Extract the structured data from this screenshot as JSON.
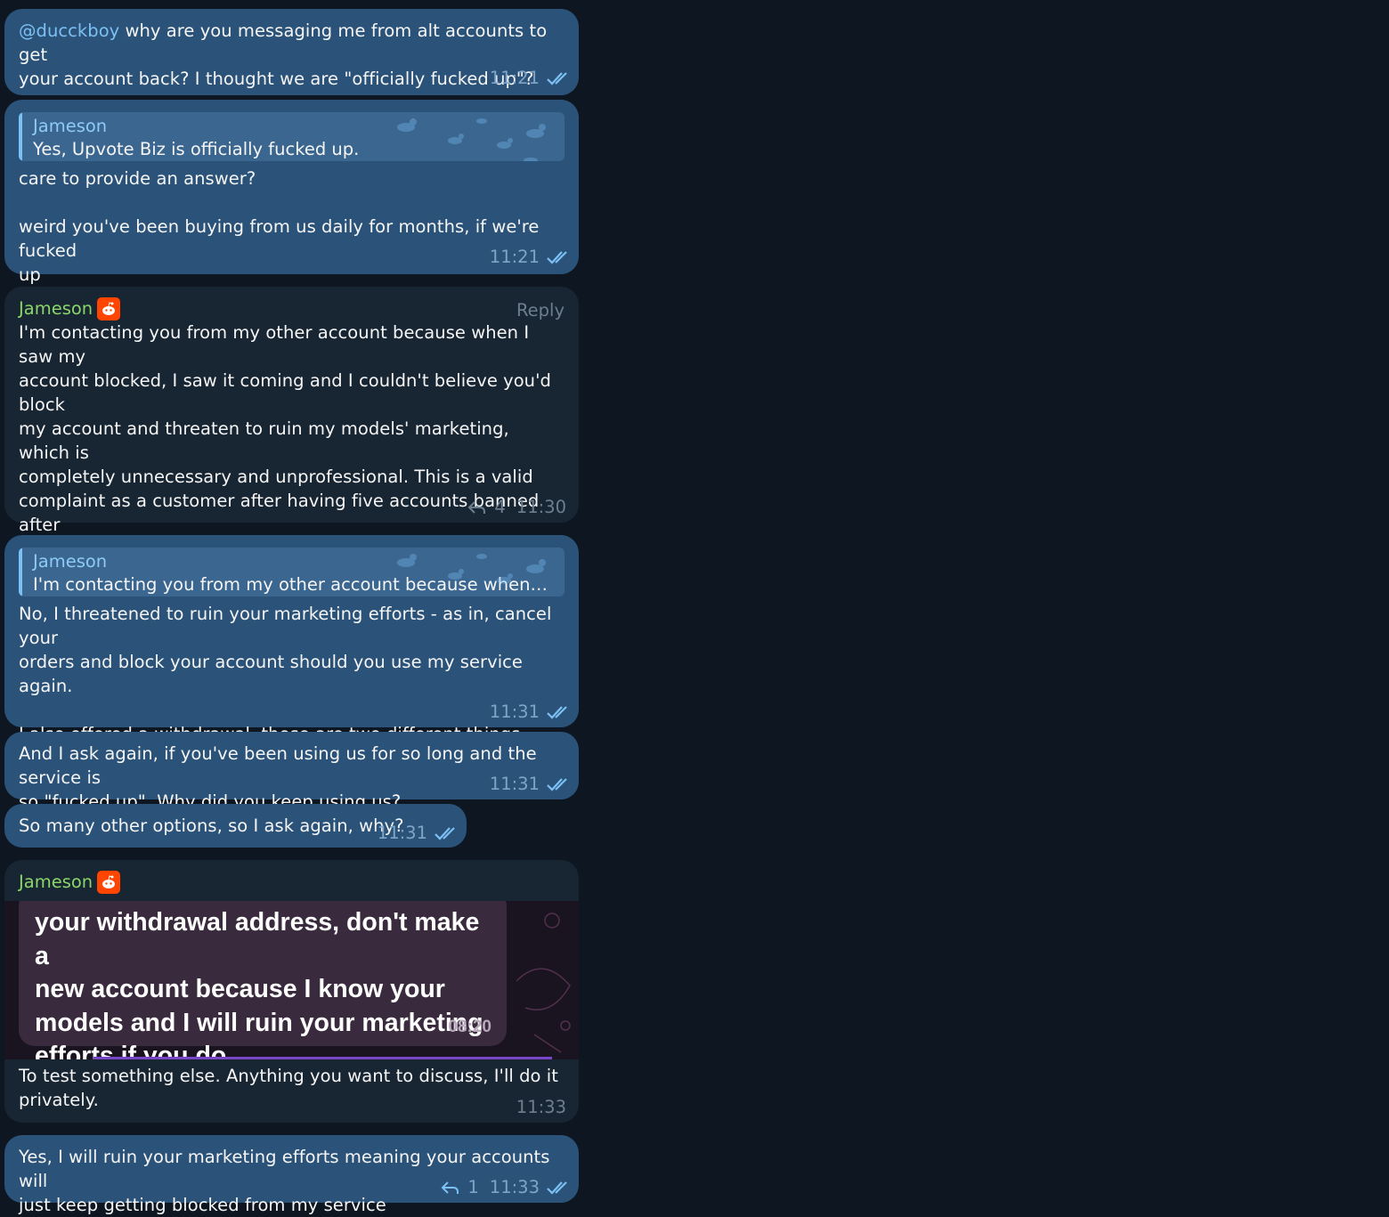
{
  "messages": {
    "m1": {
      "mention": "@ducckboy",
      "text": " why are you messaging me from alt accounts to get\nyour account back? I thought we are \"officially fucked up\"?",
      "time": "11:21"
    },
    "m2": {
      "quote_name": "Jameson",
      "quote_text": "Yes, Upvote Biz is officially fucked up.",
      "text": "care to provide an answer?\n\nweird you've been buying from us daily for months, if we're fucked\nup",
      "time": "11:21"
    },
    "m3": {
      "sender": "Jameson",
      "reply_label": "Reply",
      "text": "I'm contacting you from my other account because when I saw my\naccount blocked, I saw it coming and I couldn't believe you'd block\nmy account and threaten to ruin my models' marketing, which is\ncompletely unnecessary and unprofessional. This is a valid\ncomplaint as a customer after having five accounts banned after\nusing the service; it's not a personal attack. Nothing new, and as\nmessed up as many other things that are said. But it's fine, I won't\nuse the service again.",
      "reply_count": "4",
      "time": "11:30"
    },
    "m4": {
      "quote_name": "Jameson",
      "quote_text": "I'm contacting you from my other account because when I saw ...",
      "text": "No, I threatened to ruin your marketing efforts - as in, cancel your\norders and block your account should you use my service again.\n\nI also offered a withdrawal, these are two different things.",
      "time": "11:31"
    },
    "m5": {
      "text": "And I ask again, if you've been using us for so long and the service is\nso \"fucked up\". Why did you keep using us?",
      "time": "11:31"
    },
    "m6": {
      "text": "So many other options, so I ask again, why?",
      "time": "11:31"
    },
    "m7": {
      "sender": "Jameson",
      "media_text": "your withdrawal address, don't make a\nnew account because I know your\nmodels and I will ruin your marketing\nefforts if you do.",
      "media_time": "08:20",
      "text": "To test something else. Anything you want to discuss, I'll do it\nprivately.",
      "time": "11:33"
    },
    "m8": {
      "text": "Yes, I will ruin your marketing efforts meaning your accounts will\njust keep getting blocked from my service",
      "reply_count": "1",
      "time": "11:33"
    }
  },
  "colors": {
    "background": "#0e1621",
    "outgoing_bubble": "#2b5278",
    "incoming_bubble": "#182533",
    "sender_name": "#8ad669",
    "link": "#7cc1f5",
    "badge": "#ff4500"
  },
  "icons": {
    "read_receipt": "double-check-icon",
    "reply": "reply-arrow-icon",
    "sender_badge": "reddit-icon"
  }
}
